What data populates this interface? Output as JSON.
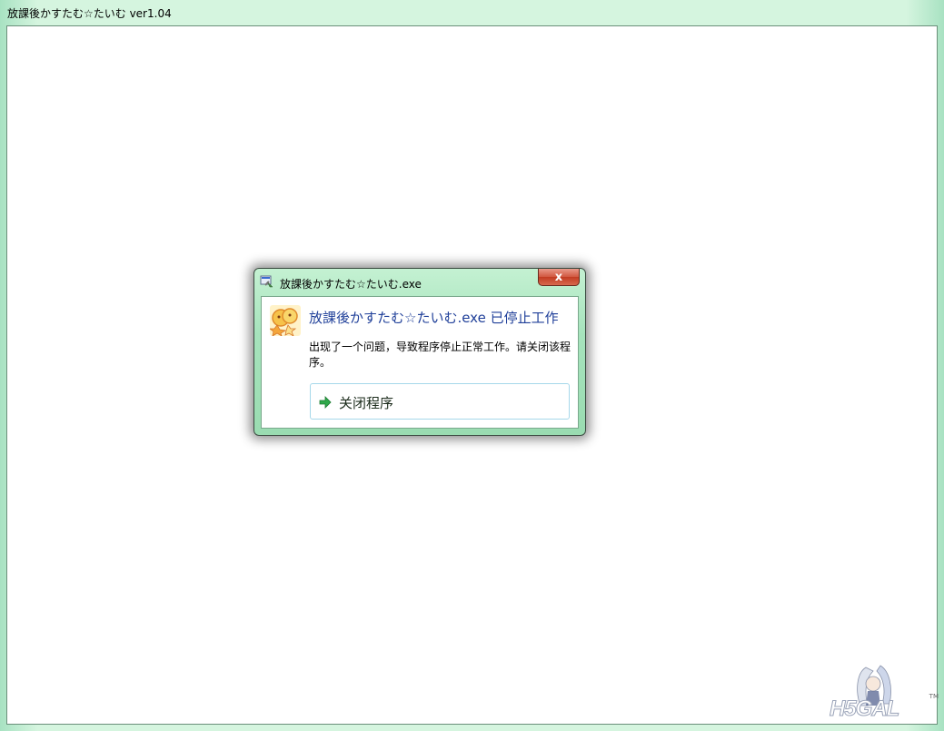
{
  "main_window": {
    "title": "放課後かすたむ☆たいむ ver1.04"
  },
  "dialog": {
    "title": "放課後かすたむ☆たいむ.exe",
    "close_label": "x",
    "headline": "放課後かすたむ☆たいむ.exe 已停止工作",
    "message": "出现了一个问题，导致程序停止正常工作。请关闭该程序。",
    "action_label": "关闭程序"
  },
  "watermark": {
    "text": "H5GAL",
    "tm": "TM"
  },
  "icons": {
    "dialog_app": "app-icon",
    "program": "program-icon",
    "arrow": "green-arrow-icon"
  },
  "colors": {
    "headline": "#1f3f99",
    "dialog_frame": "#a6e3bc",
    "close_button": "#c23c22",
    "arrow": "#2fa84a"
  }
}
